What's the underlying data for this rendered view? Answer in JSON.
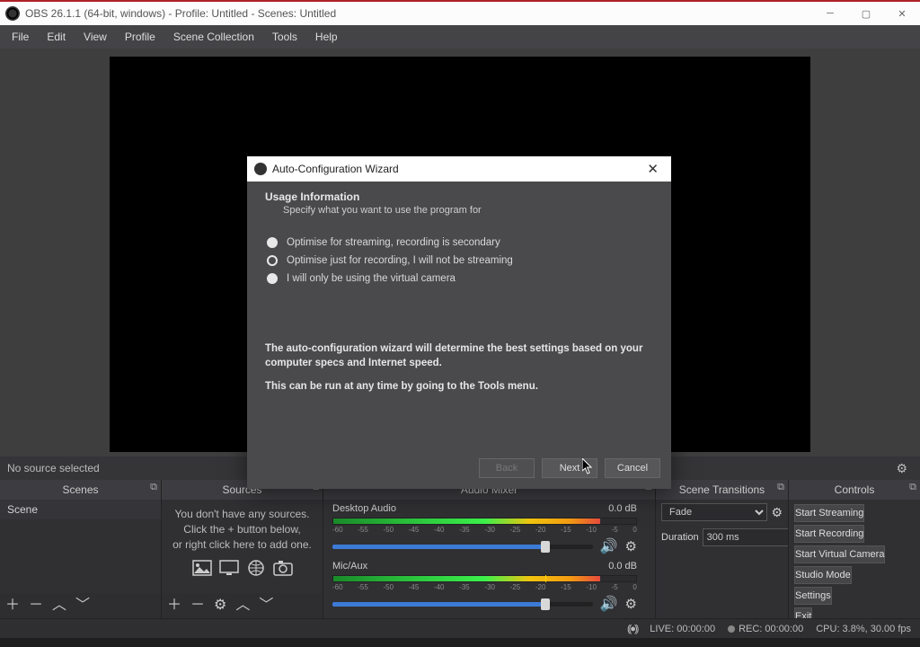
{
  "window": {
    "title": "OBS 26.1.1 (64-bit, windows) - Profile: Untitled - Scenes: Untitled"
  },
  "menu": [
    "File",
    "Edit",
    "View",
    "Profile",
    "Scene Collection",
    "Tools",
    "Help"
  ],
  "status_row": {
    "no_source": "No source selected"
  },
  "panels": {
    "scenes": {
      "title": "Scenes",
      "items": [
        "Scene"
      ]
    },
    "sources": {
      "title": "Sources",
      "msg_line1": "You don't have any sources.",
      "msg_line2": "Click the + button below,",
      "msg_line3": "or right click here to add one."
    },
    "mixer": {
      "title": "Audio Mixer",
      "tracks": [
        {
          "name": "Desktop Audio",
          "db": "0.0 dB",
          "fill_pct": 82
        },
        {
          "name": "Mic/Aux",
          "db": "0.0 dB",
          "fill_pct": 82
        }
      ],
      "scale": [
        "-60",
        "-55",
        "-50",
        "-45",
        "-40",
        "-35",
        "-30",
        "-25",
        "-20",
        "-15",
        "-10",
        "-5",
        "0"
      ]
    },
    "transitions": {
      "title": "Scene Transitions",
      "current": "Fade",
      "duration_label": "Duration",
      "duration_value": "300 ms"
    },
    "controls": {
      "title": "Controls",
      "buttons": [
        "Start Streaming",
        "Start Recording",
        "Start Virtual Camera",
        "Studio Mode",
        "Settings",
        "Exit"
      ]
    }
  },
  "statusbar": {
    "live": "LIVE: 00:00:00",
    "rec": "REC: 00:00:00",
    "cpu": "CPU: 3.8%, 30.00 fps"
  },
  "dialog": {
    "title": "Auto-Configuration Wizard",
    "header": "Usage Information",
    "subheader": "Specify what you want to use the program for",
    "options": [
      "Optimise for streaming, recording is secondary",
      "Optimise just for recording, I will not be streaming",
      "I will only be using the virtual camera"
    ],
    "selected_index": 1,
    "desc1": "The auto-configuration wizard will determine the best settings based on your computer specs and Internet speed.",
    "desc2": "This can be run at any time by going to the Tools menu.",
    "buttons": {
      "back": "Back",
      "next": "Next",
      "cancel": "Cancel"
    }
  }
}
